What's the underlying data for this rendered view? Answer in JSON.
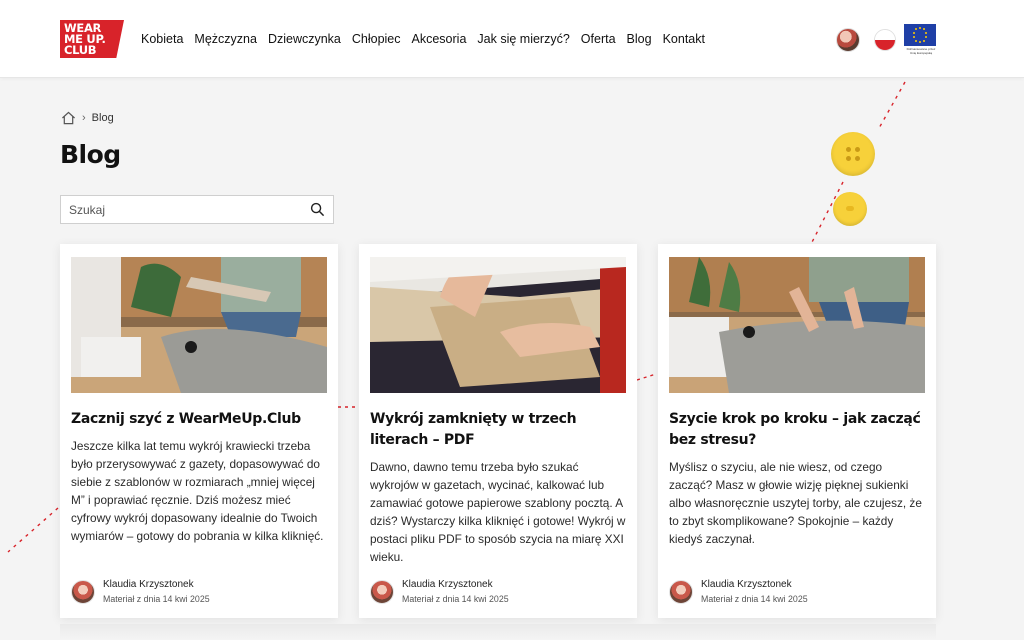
{
  "brand": {
    "logo_line1": "WEAR",
    "logo_line2": "ME UP.",
    "logo_line3": "CLUB",
    "eu_caption": "Dofinansowane przez Unię Europejską",
    "accent_color": "#d8232a"
  },
  "nav": {
    "items": [
      "Kobieta",
      "Mężczyzna",
      "Dziewczynka",
      "Chłopiec",
      "Akcesoria",
      "Jak się mierzyć?",
      "Oferta",
      "Blog",
      "Kontakt"
    ]
  },
  "breadcrumb": {
    "home_icon": "home-icon",
    "current": "Blog"
  },
  "page": {
    "title": "Blog"
  },
  "search": {
    "placeholder": "Szukaj",
    "icon": "search-icon"
  },
  "posts": [
    {
      "title": "Zacznij szyć z WearMeUp.Club",
      "excerpt": "Jeszcze kilka lat temu wykrój krawiecki trzeba było przerysowywać z gazety, dopasowywać do siebie z szablonów w rozmiarach „mniej więcej M” i poprawiać ręcznie. Dziś możesz mieć cyfrowy wykrój dopasowany idealnie do Twoich wymiarów – gotowy do pobrania w kilka kliknięć.",
      "author": "Klaudia Krzysztonek",
      "date": "Materiał z dnia 14 kwi 2025"
    },
    {
      "title": "Wykrój zamknięty w trzech literach – PDF",
      "excerpt": "Dawno, dawno temu trzeba było szukać wykrojów w gazetach, wycinać, kalkować lub zamawiać gotowe papierowe szablony pocztą. A dziś? Wystarczy kilka kliknięć i gotowe! Wykrój w postaci pliku PDF to sposób szycia na miarę XXI wieku.",
      "author": "Klaudia Krzysztonek",
      "date": "Materiał z dnia 14 kwi 2025"
    },
    {
      "title": "Szycie krok po kroku – jak zacząć bez stresu?",
      "excerpt": "Myślisz o szyciu, ale nie wiesz, od czego zacząć? Masz w głowie wizję pięknej sukienki albo własnoręcznie uszytej torby, ale czujesz, że to zbyt skomplikowane? Spokojnie – każdy kiedyś zaczynał.",
      "author": "Klaudia Krzysztonek",
      "date": "Materiał z dnia 14 kwi 2025"
    }
  ]
}
